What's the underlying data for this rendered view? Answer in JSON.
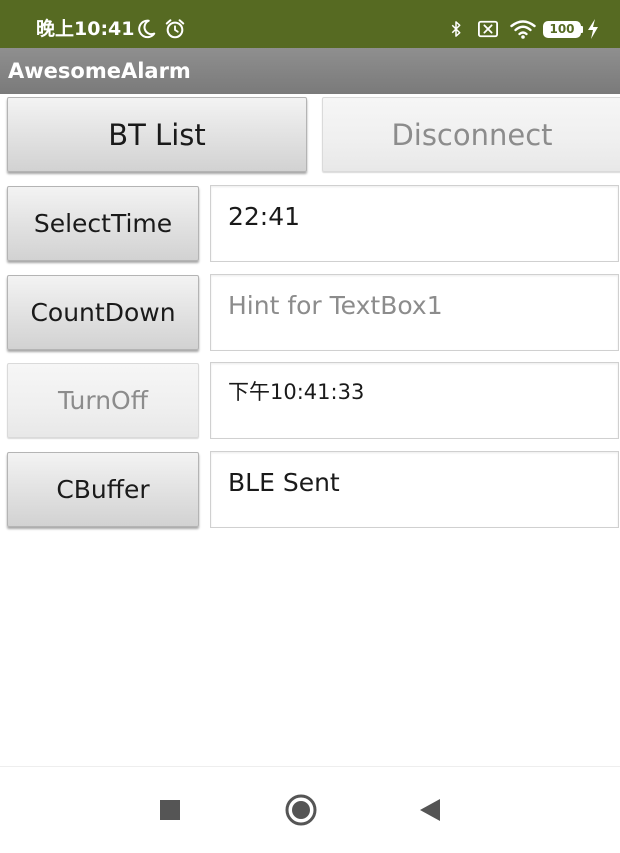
{
  "status_bar": {
    "time": "晚上10:41",
    "battery": "100",
    "icons": [
      "moon-icon",
      "alarm-clock-icon",
      "bluetooth-icon",
      "sim-off-icon",
      "wifi-icon",
      "charging-icon"
    ]
  },
  "app": {
    "title": "AwesomeAlarm"
  },
  "buttons": {
    "bt_list": "BT List",
    "disconnect": "Disconnect",
    "select_time": "SelectTime",
    "count_down": "CountDown",
    "turn_off": "TurnOff",
    "cbuffer": "CBuffer"
  },
  "fields": {
    "time_value": "22:41",
    "textbox1_hint": "Hint for TextBox1",
    "clock_value": "下午10:41:33",
    "ble_status": "BLE Sent"
  },
  "colors": {
    "status_bar": "#566a22",
    "title_bar": "#808080"
  },
  "nav_bar": {
    "icons": [
      "recent-apps-icon",
      "home-icon",
      "back-icon"
    ]
  }
}
